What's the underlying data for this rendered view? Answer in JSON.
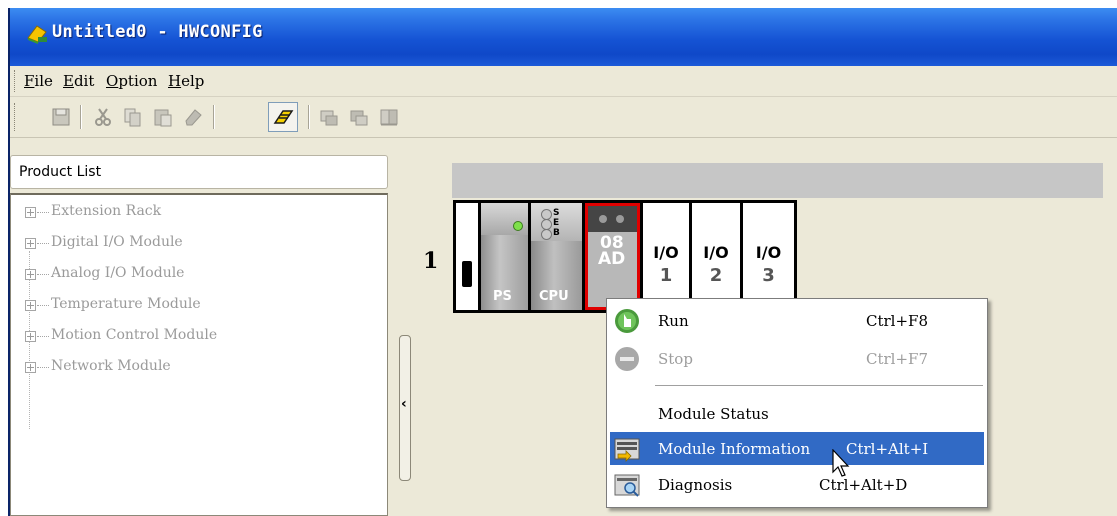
{
  "window": {
    "title": "Untitled0 - HWCONFIG"
  },
  "menu": {
    "items": [
      {
        "underline": "F",
        "rest": "ile"
      },
      {
        "underline": "E",
        "rest": "dit"
      },
      {
        "underline": "O",
        "rest": "ption"
      },
      {
        "underline": "H",
        "rest": "elp"
      }
    ]
  },
  "toolbar": {
    "buttons": [
      "save-icon",
      "cut-icon",
      "copy-icon",
      "paste-icon",
      "eraser-icon",
      "online-mode-icon",
      "upload-icon",
      "download-icon",
      "compare-icon"
    ]
  },
  "product_list": {
    "title": "Product List",
    "items": [
      "Extension Rack",
      "Digital I/O Module",
      "Analog I/O Module",
      "Temperature Module",
      "Motion Control Module",
      "Network Module"
    ]
  },
  "rack": {
    "number": "1",
    "ps_label": "PS",
    "cpu_label": "CPU",
    "cpu_leds": [
      "S",
      "E",
      "B"
    ],
    "ad_module": {
      "line1": "08",
      "line2": "AD"
    },
    "io_slots": [
      {
        "label": "I/O",
        "number": "1"
      },
      {
        "label": "I/O",
        "number": "2"
      },
      {
        "label": "I/O",
        "number": "3"
      }
    ]
  },
  "context_menu": {
    "items": [
      {
        "label": "Run",
        "shortcut": "Ctrl+F8",
        "icon": "run-icon",
        "disabled": false,
        "highlighted": false
      },
      {
        "label": "Stop",
        "shortcut": "Ctrl+F7",
        "icon": "stop-icon",
        "disabled": true,
        "highlighted": false
      },
      {
        "label": "Module Status",
        "shortcut": "",
        "icon": "",
        "disabled": false,
        "highlighted": false
      },
      {
        "label": "Module Information",
        "shortcut": "Ctrl+Alt+I",
        "icon": "module-info-icon",
        "disabled": false,
        "highlighted": true
      },
      {
        "label": "Diagnosis",
        "shortcut": "Ctrl+Alt+D",
        "icon": "diagnosis-icon",
        "disabled": false,
        "highlighted": false
      }
    ]
  },
  "colors": {
    "title_bar": "#0f48c8",
    "highlight": "#316ac5",
    "selected_module_border": "#e00000",
    "rack_bar": "#c6c6c6"
  }
}
